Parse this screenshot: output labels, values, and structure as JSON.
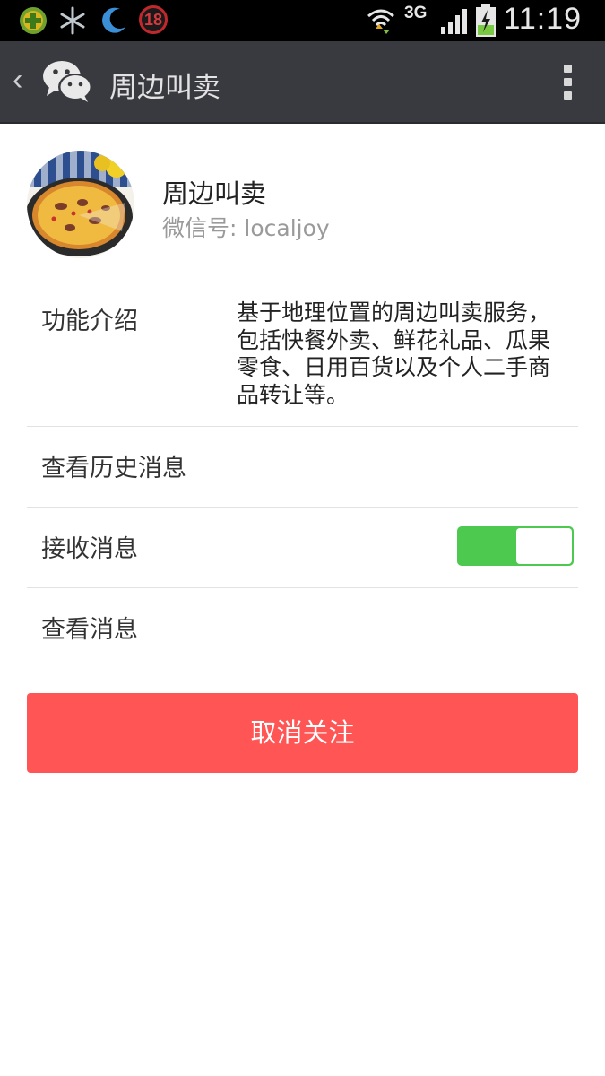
{
  "status_bar": {
    "notification_icons": [
      "add-circle-icon",
      "snowflake-icon",
      "moon-icon",
      "badge-icon"
    ],
    "badge_count": "18",
    "network_type": "3G",
    "time": "11:19"
  },
  "title_bar": {
    "back_label": "‹",
    "title": "周边叫卖"
  },
  "profile": {
    "name": "周边叫卖",
    "wechat_id_label": "微信号:",
    "wechat_id": "localjoy"
  },
  "rows": {
    "intro": {
      "label": "功能介绍",
      "value": "基于地理位置的周边叫卖服务，包括快餐外卖、鲜花礼品、瓜果零食、日用百货以及个人二手商品转让等。"
    },
    "history": {
      "label": "查看历史消息"
    },
    "receive": {
      "label": "接收消息",
      "toggle_on": true
    },
    "view": {
      "label": "查看消息"
    }
  },
  "actions": {
    "unfollow_label": "取消关注"
  },
  "colors": {
    "titlebar": "#393a3f",
    "toggle_on": "#4cc94e",
    "unfollow": "#ff5555"
  }
}
